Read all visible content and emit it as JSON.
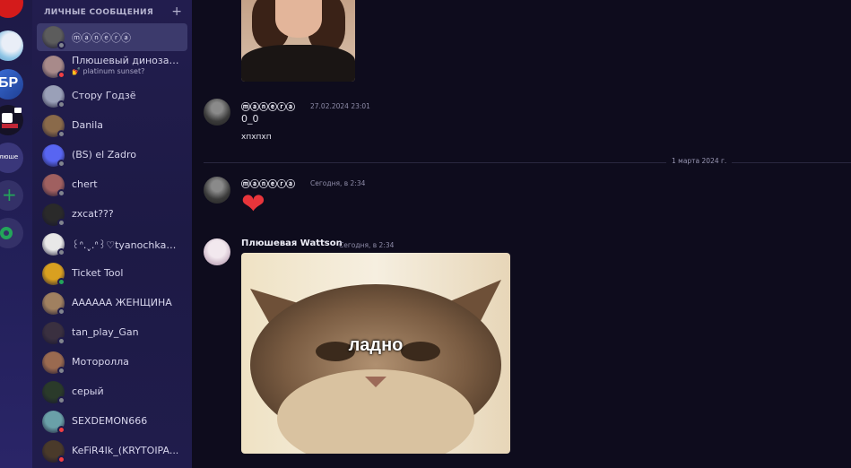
{
  "sidebar": {
    "header": "ЛИЧНЫЕ СООБЩЕНИЯ",
    "add_icon": "+",
    "items": [
      {
        "name": "ⓜⓐⓝⓔⓡⓐ",
        "status": "offline",
        "active": true
      },
      {
        "name": "Плюшевый динозав...",
        "subtitle": "💅 platinum sunset?",
        "status": "dnd"
      },
      {
        "name": "Стору Годзё",
        "status": "offline"
      },
      {
        "name": "Danila",
        "status": "offline"
      },
      {
        "name": "(BS) el Zadro",
        "status": "offline"
      },
      {
        "name": "chert",
        "status": "offline"
      },
      {
        "name": "zxcat???",
        "status": "offline"
      },
      {
        "name": "꒰ᐢ.ˬ.ᐢ꒱♡tyanochka♡...",
        "status": "offline"
      },
      {
        "name": "Ticket Tool",
        "status": "online"
      },
      {
        "name": "АААААА ЖЕНЩИНА",
        "status": "offline"
      },
      {
        "name": "tan_play_Gan",
        "status": "offline"
      },
      {
        "name": "Моторолла",
        "status": "offline"
      },
      {
        "name": "серый",
        "status": "offline"
      },
      {
        "name": "SEXDEMON666",
        "status": "dnd"
      },
      {
        "name": "KeFiR4Ik_(KRYTOIPA...",
        "status": "dnd"
      }
    ]
  },
  "servers": {
    "server_label": "Плюше",
    "add_icon": "+",
    "discover_icon": "compass-icon"
  },
  "chat": {
    "messages": [
      {
        "author": "ⓜⓐⓝⓔⓡⓐ",
        "timestamp": "27.02.2024 23:01",
        "lines": [
          "0_0",
          "хпхпхп"
        ]
      },
      {
        "author": "ⓜⓐⓝⓔⓡⓐ",
        "timestamp": "Сегодня, в 2:34",
        "emoji": "❤"
      },
      {
        "author": "Плюшевая Wattson",
        "timestamp": "Сегодня, в 2:34",
        "image_caption": "ладно"
      }
    ],
    "date_divider": "1 марта 2024 г."
  },
  "colors": {
    "online": "#23a55a",
    "offline": "#80848e",
    "dnd": "#f23f43",
    "heart": "#e8353b"
  }
}
